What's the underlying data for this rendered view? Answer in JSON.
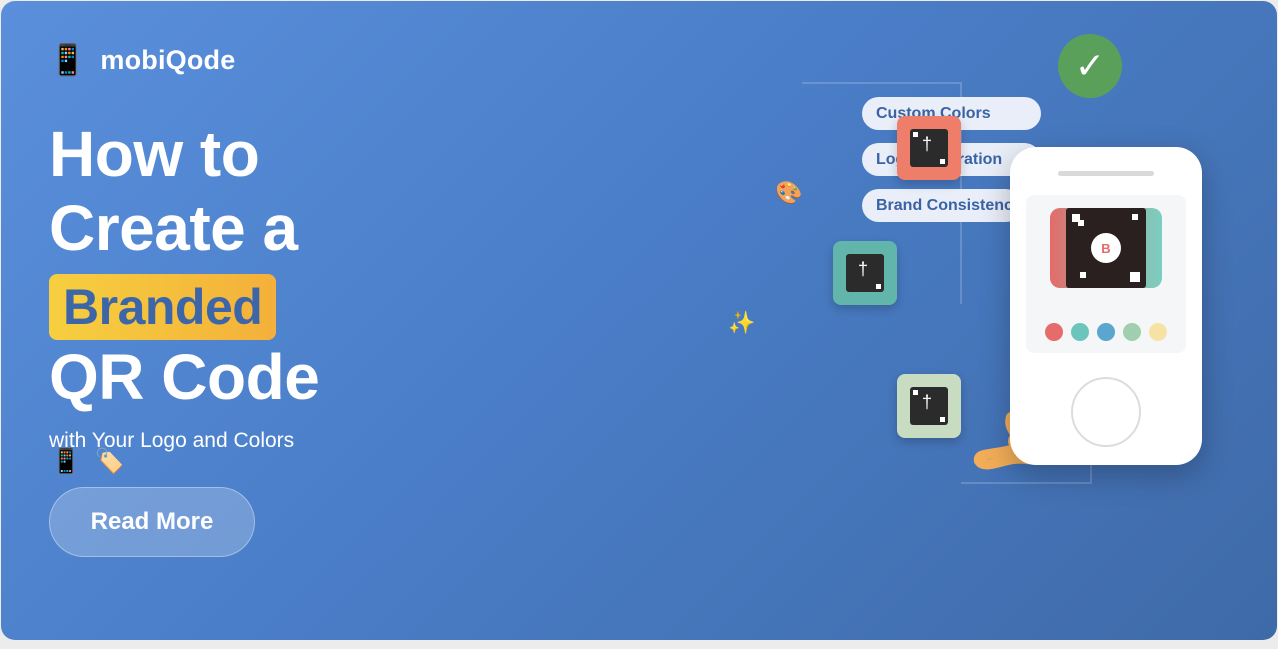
{
  "brand": {
    "icon": "mobile-phone-icon",
    "name": "mobiQode"
  },
  "headline": {
    "line1": "How to",
    "line2": "Create a",
    "highlight": "Branded",
    "line4": "QR Code"
  },
  "subtitle": "with Your Logo and Colors",
  "emoji_row": {
    "phone": "📱",
    "tag": "🏷️"
  },
  "cta": {
    "label": "Read More"
  },
  "illustration": {
    "pills": [
      "Custom Colors",
      "Logo Integration",
      "Brand Consistency"
    ],
    "check_glyph": "✓",
    "qr_logo_letter": "B",
    "palette_glyph": "🎨",
    "sparkle_glyph": "✨",
    "swatch_colors": [
      "#e66b6b",
      "#6cc5bd",
      "#5aa6cf",
      "#9fcfae",
      "#f7e2a6"
    ],
    "tile_colors": [
      "#ee7e6a",
      "#62b5ab",
      "#c8dcc2"
    ]
  }
}
